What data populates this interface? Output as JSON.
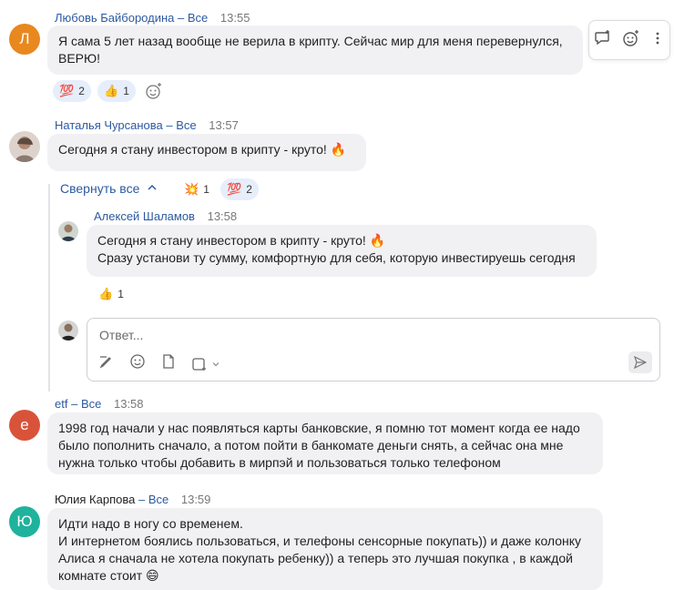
{
  "toolbar": {
    "icons": [
      "reply-thread-icon",
      "add-reaction-icon",
      "more-icon"
    ]
  },
  "messages": [
    {
      "avatar_letter": "Л",
      "avatar_color": "#e8881f",
      "name": "Любовь Байбородина",
      "dash": "–",
      "all": "Все",
      "time": "13:55",
      "lines": [
        "Я сама 5 лет назад вообще не верила в крипту. Сейчас мир для меня перевернулся,",
        "ВЕРЮ!"
      ],
      "reactions": [
        {
          "emoji": "💯",
          "count": "2"
        },
        {
          "emoji": "👍",
          "count": "1"
        }
      ]
    },
    {
      "name": "Наталья Чурсанова",
      "dash": "–",
      "all": "Все",
      "time": "13:57",
      "lines": [
        "Сегодня я стану инвестором в крипту - круто! 🔥"
      ],
      "collapse_label": "Свернуть все",
      "reactions": [
        {
          "emoji": "💥",
          "count": "1"
        },
        {
          "emoji": "💯",
          "count": "2"
        }
      ]
    },
    {
      "name": "Алексей Шаламов",
      "time": "13:58",
      "lines": [
        "Сегодня я стану инвестором в крипту - круто! 🔥",
        "Сразу установи ту сумму, комфортную для себя, которую инвестируешь сегодня"
      ],
      "reactions": [
        {
          "emoji": "👍",
          "count": "1"
        }
      ]
    },
    {
      "avatar_letter": "e",
      "avatar_color": "#d9533a",
      "name": "etf",
      "dash": "–",
      "all": "Все",
      "time": "13:58",
      "lines": [
        "1998 год начали у нас появляться карты банковские, я помню тот момент когда ее надо",
        "было пополнить сначало, а потом пойти в банкомате деньги снять, а сейчас она мне",
        "нужна только чтобы добавить в мирпэй и пользоваться только телефоном"
      ]
    },
    {
      "avatar_letter": "Ю",
      "avatar_color": "#1fb29c",
      "name": "Юлия Карпова",
      "dash": "–",
      "all": "Все",
      "time": "13:59",
      "lines": [
        "Идти надо в ногу со временем.",
        "И интернетом боялись пользоваться, и телефоны сенсорные покупать)) и даже колонку",
        "Алиса я сначала не хотела покупать ребенку)) а теперь это лучшая покупка , в каждой",
        "комнате стоит 😄"
      ]
    }
  ],
  "reply": {
    "placeholder": "Ответ..."
  }
}
